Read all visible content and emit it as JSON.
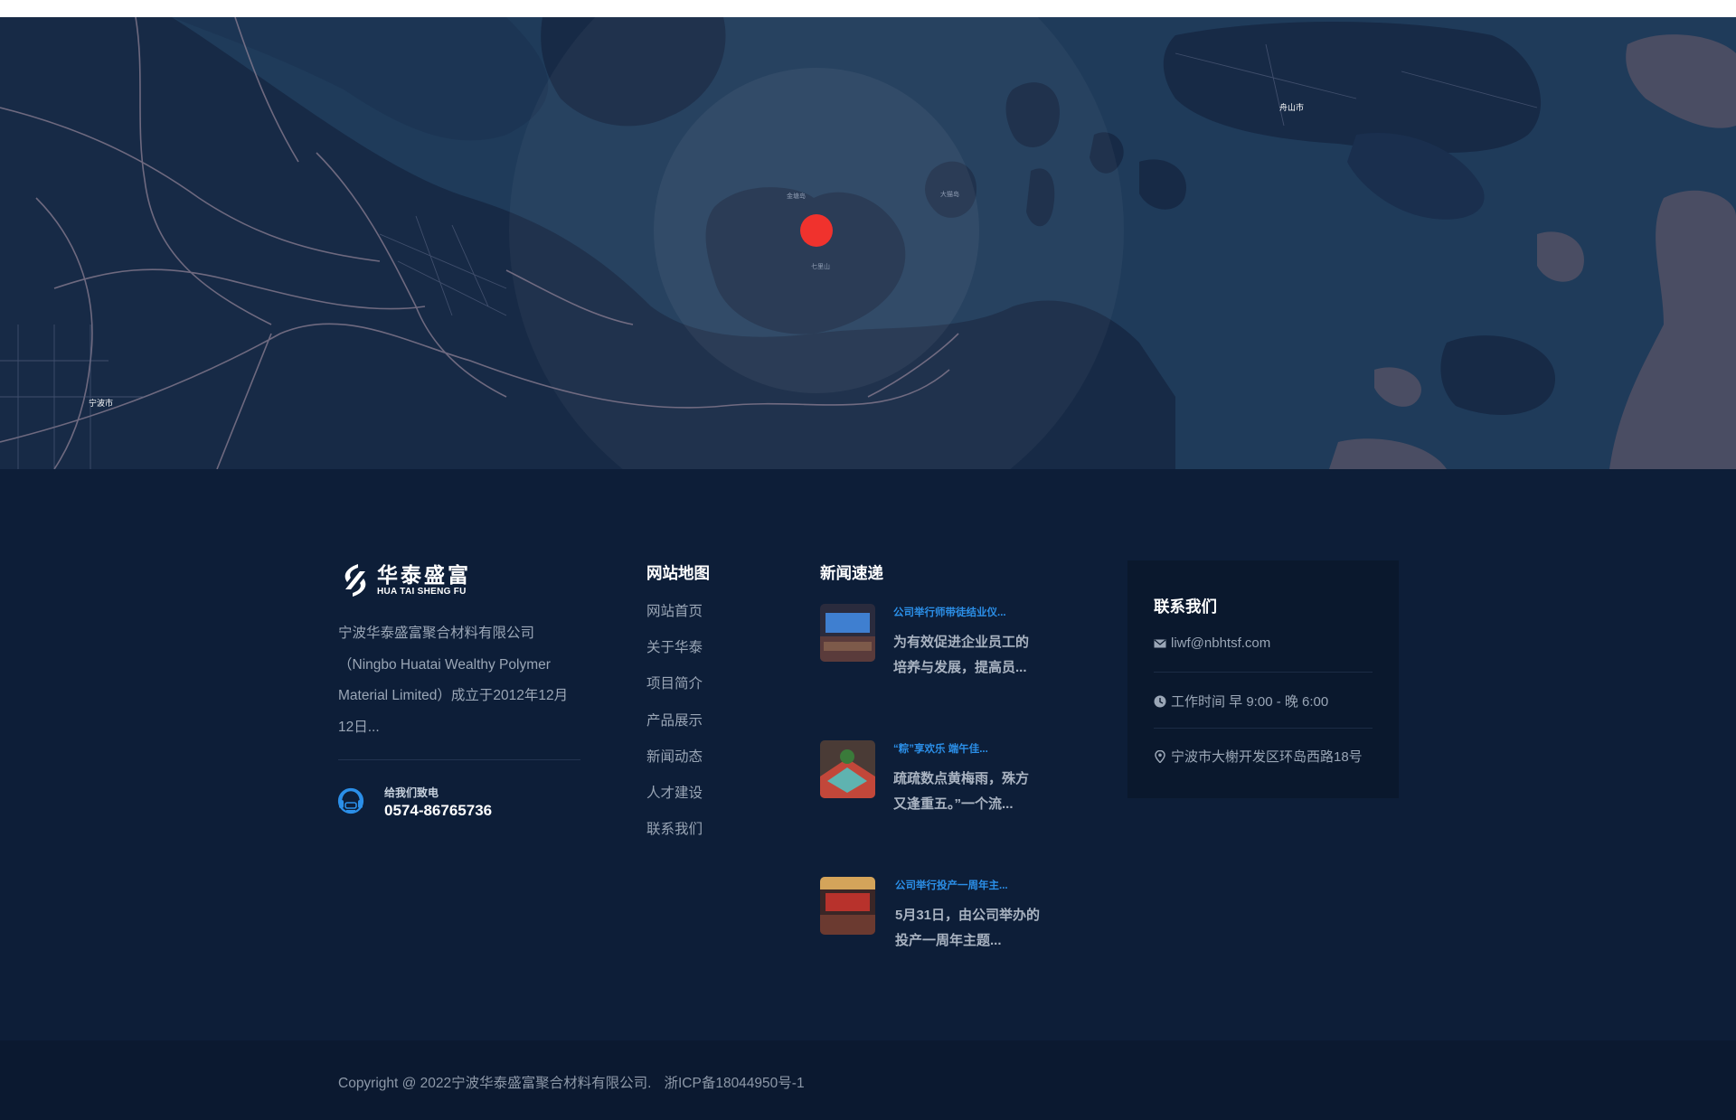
{
  "map": {
    "place_labels": [
      "宁波市",
      "舟山市",
      "七里山",
      "大猫岛",
      "金塘岛"
    ]
  },
  "company": {
    "logo_cn": "华泰盛富",
    "logo_en": "HUA TAI SHENG FU",
    "intro": "宁波华泰盛富聚合材料有限公司（Ningbo Huatai Wealthy Polymer Material Limited）成立于2012年12月12日...",
    "phone_label": "给我们致电",
    "phone": "0574-86765736"
  },
  "sitemap": {
    "title": "网站地图",
    "items": [
      {
        "label": "网站首页"
      },
      {
        "label": "关于华泰"
      },
      {
        "label": "项目简介"
      },
      {
        "label": "产品展示"
      },
      {
        "label": "新闻动态"
      },
      {
        "label": "人才建设"
      },
      {
        "label": "联系我们"
      }
    ]
  },
  "news": {
    "title": "新闻速递",
    "items": [
      {
        "title": "公司举行师带徒结业仪...",
        "desc": "为有效促进企业员工的培养与发展，提高员..."
      },
      {
        "title": "“粽”享欢乐 端午佳...",
        "desc": "疏疏数点黄梅雨，殊方又逢重五。”一个流..."
      },
      {
        "title": "公司举行投产一周年主...",
        "desc": "5月31日，由公司举办的投产一周年主题..."
      }
    ]
  },
  "contact": {
    "title": "联系我们",
    "email": "liwf@nbhtsf.com",
    "hours": "工作时间 早 9:00 - 晚 6:00",
    "address": "宁波市大榭开发区环岛西路18号"
  },
  "footer": {
    "copyright": "Copyright @ 2022宁波华泰盛富聚合材料有限公司.",
    "icp": "浙ICP备18044950号-1"
  },
  "colors": {
    "background": "#0d1e38",
    "accent_blue": "#2b8fe8",
    "marker_red": "#f0322d",
    "map_land": "#172a46",
    "map_water": "#1f3b5a"
  }
}
